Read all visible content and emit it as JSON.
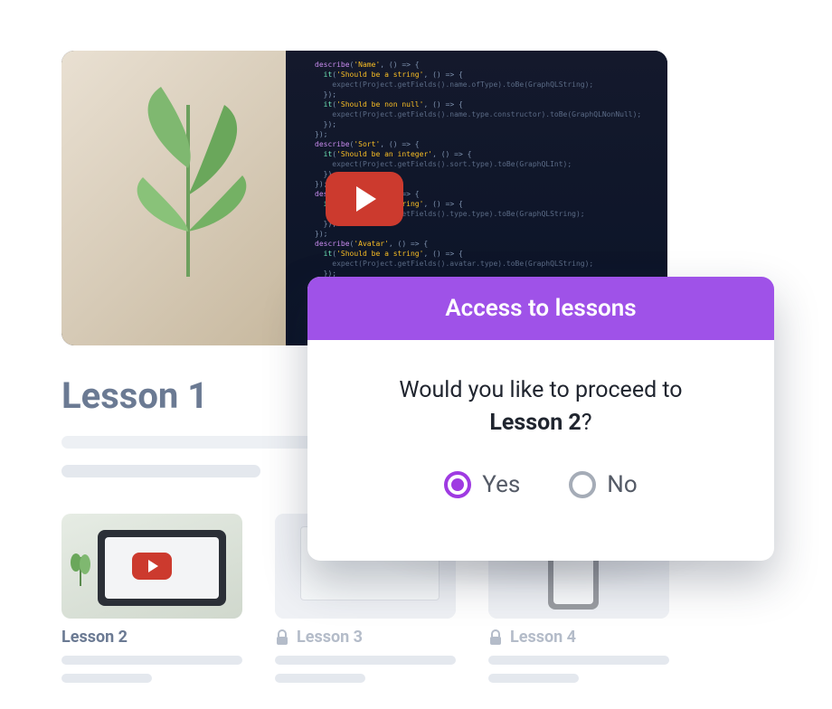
{
  "hero": {
    "title": "Lesson 1",
    "play_icon": "play-icon"
  },
  "lessons": [
    {
      "label": "Lesson 2",
      "locked": false,
      "has_play": true
    },
    {
      "label": "Lesson 3",
      "locked": true,
      "has_play": false
    },
    {
      "label": "Lesson 4",
      "locked": true,
      "has_play": false
    }
  ],
  "modal": {
    "title": "Access to lessons",
    "question_prefix": "Would you like to proceed to ",
    "question_bold": "Lesson 2",
    "question_suffix": "?",
    "options": {
      "yes": "Yes",
      "no": "No"
    },
    "selected": "yes",
    "colors": {
      "accent": "#9f52e8",
      "radio_selected": "#9f3ae2"
    }
  }
}
